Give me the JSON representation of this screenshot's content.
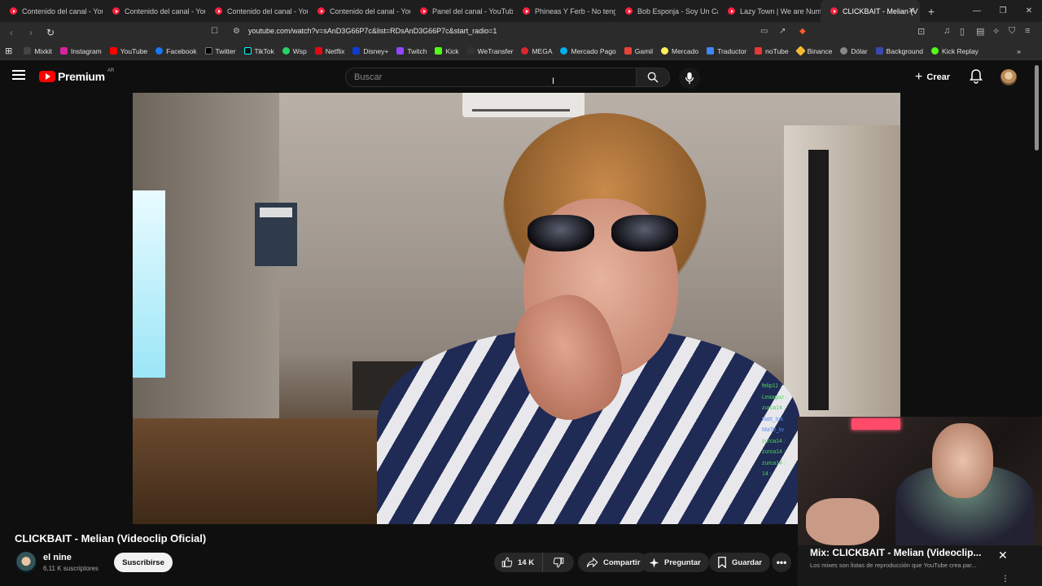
{
  "browser": {
    "tabs": [
      {
        "title": "Contenido del canal - You"
      },
      {
        "title": "Contenido del canal - You"
      },
      {
        "title": "Contenido del canal - You"
      },
      {
        "title": "Contenido del canal - You"
      },
      {
        "title": "Panel del canal - YouTube"
      },
      {
        "title": "Phineas Y Ferb - No tengo"
      },
      {
        "title": "Bob Esponja - Soy Un Cac"
      },
      {
        "title": "Lazy Town | We are Numb"
      },
      {
        "title": "CLICKBAIT - Melian (V",
        "active": true
      }
    ],
    "url": "youtube.com/watch?v=sAnD3G66P7c&list=RDsAnD3G66P7c&start_radio=1",
    "bookmarks": [
      {
        "label": "Mixkit",
        "color": "#444444"
      },
      {
        "label": "Instagram",
        "color": "#d6249f"
      },
      {
        "label": "YouTube",
        "color": "#ff0000"
      },
      {
        "label": "Facebook",
        "color": "#1877f2"
      },
      {
        "label": "Twitter",
        "color": "#000000"
      },
      {
        "label": "TikTok",
        "color": "#111111"
      },
      {
        "label": "Wsp",
        "color": "#25d366"
      },
      {
        "label": "Netflix",
        "color": "#e50914"
      },
      {
        "label": "Disney+",
        "color": "#113ccf"
      },
      {
        "label": "Twitch",
        "color": "#9146ff"
      },
      {
        "label": "Kick",
        "color": "#53fc18"
      },
      {
        "label": "WeTransfer",
        "color": "#333333"
      },
      {
        "label": "MEGA",
        "color": "#d9272e"
      },
      {
        "label": "Mercado Pago",
        "color": "#00b1ea"
      },
      {
        "label": "Gamil",
        "color": "#ea4335"
      },
      {
        "label": "Mercado",
        "color": "#fff159"
      },
      {
        "label": "Traductor",
        "color": "#4285f4"
      },
      {
        "label": "noTube",
        "color": "#e53935"
      },
      {
        "label": "Binance",
        "color": "#f3ba2f"
      },
      {
        "label": "Dólar",
        "color": "#888888"
      },
      {
        "label": "Background",
        "color": "#3949ab"
      },
      {
        "label": "Kick Replay",
        "color": "#53fc18"
      }
    ]
  },
  "youtube": {
    "logo_text": "Premium",
    "country_code": "AR",
    "search_placeholder": "Buscar",
    "create_label": "Crear"
  },
  "video": {
    "title": "CLICKBAIT - Melian (Videoclip Oficial)",
    "channel_name": "el nine",
    "subscribers": "6,11 K suscriptores",
    "subscribe_label": "Suscribirse",
    "likes": "14 K",
    "share_label": "Compartir",
    "ask_label": "Preguntar",
    "save_label": "Guardar"
  },
  "chat_overlay": {
    "lines": [
      "felip11 :",
      "Leaaguz :",
      "zurca14 :",
      "Natt_tuk",
      "MaTe_to",
      "zurca14 :",
      "zurca14 :",
      "zurca14 :",
      "14 :"
    ]
  },
  "mix": {
    "title": "Mix: CLICKBAIT - Melian (Videoclip...",
    "subtitle": "Los mixes son listas de reproducción que YouTube crea par..."
  },
  "colors": {
    "accent": "#ff0000",
    "background": "#0f0f0f"
  }
}
